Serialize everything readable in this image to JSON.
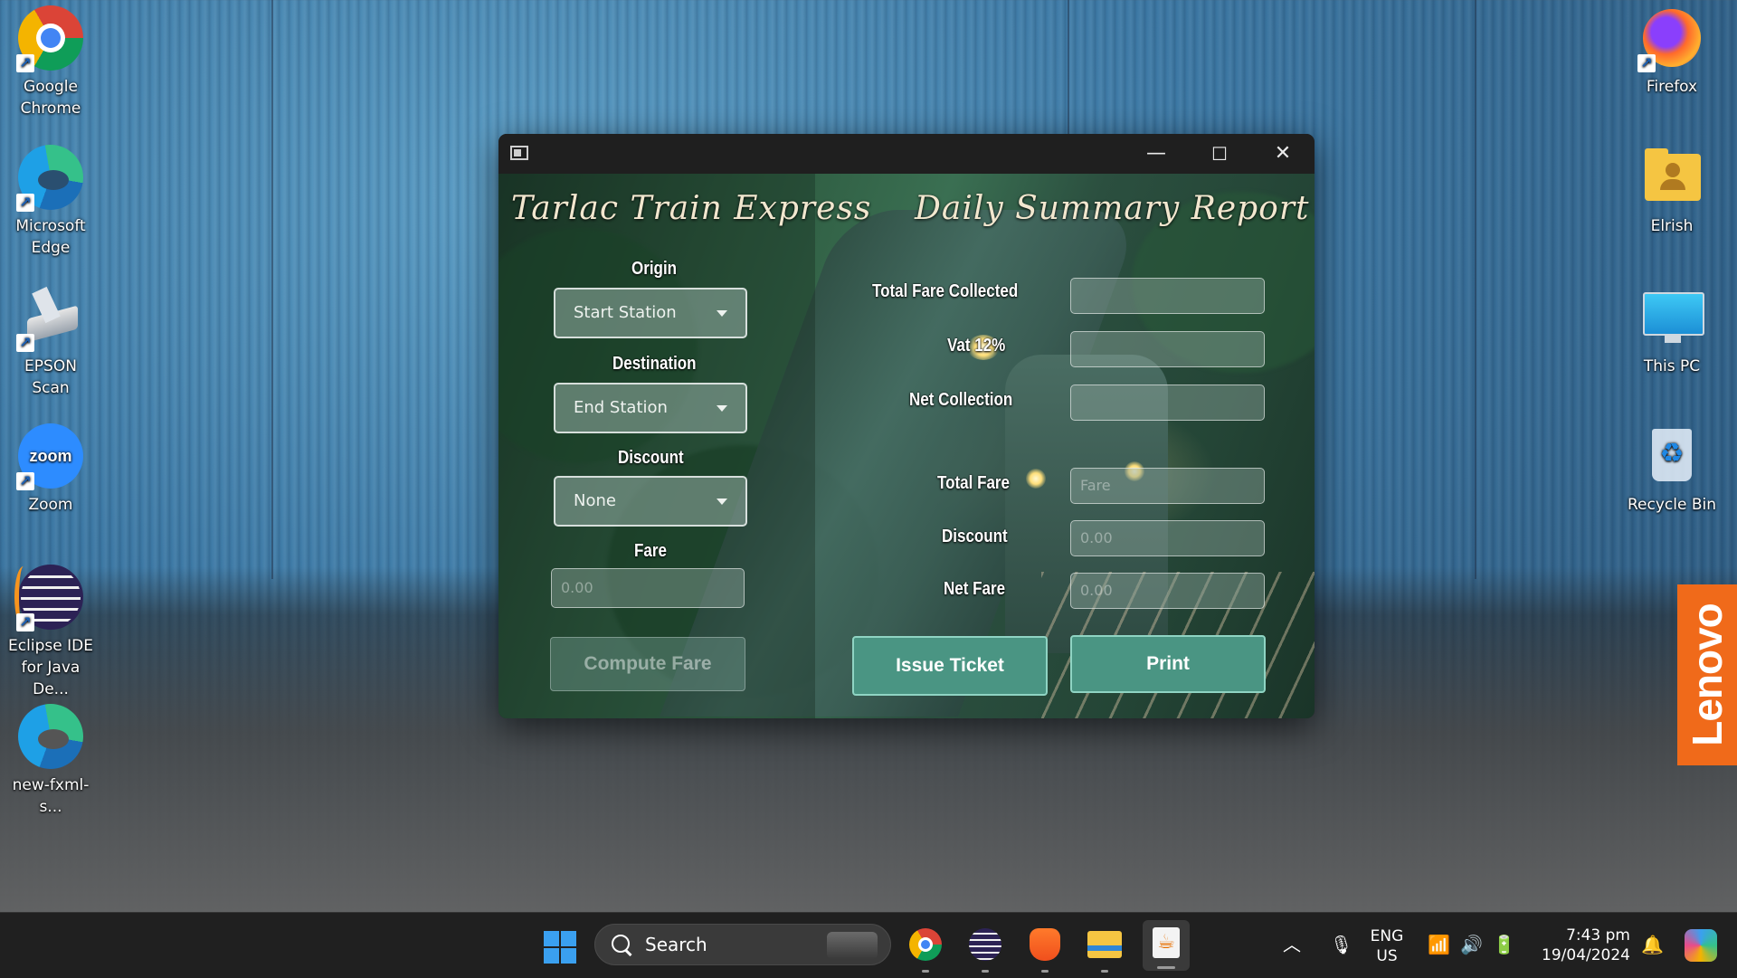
{
  "desktop": {
    "icons_left": [
      {
        "label": "Google Chrome",
        "icon": "chrome-icon"
      },
      {
        "label": "Microsoft Edge",
        "icon": "edge-icon"
      },
      {
        "label": "EPSON Scan",
        "icon": "scanner-icon"
      },
      {
        "label": "Zoom",
        "icon": "zoom-icon"
      },
      {
        "label": "Eclipse IDE for Java De...",
        "icon": "eclipse-icon"
      },
      {
        "label": "new-fxml-s...",
        "icon": "edge-icon"
      }
    ],
    "icons_right": [
      {
        "label": "Firefox",
        "icon": "firefox-icon"
      },
      {
        "label": "Elrish",
        "icon": "user-folder-icon"
      },
      {
        "label": "This PC",
        "icon": "monitor-icon"
      },
      {
        "label": "Recycle Bin",
        "icon": "recycle-bin-icon"
      }
    ],
    "zoom_logo_text": "zoom",
    "lenovo_text": "Lenovo"
  },
  "window": {
    "controls": {
      "minimize": "—",
      "maximize": "☐",
      "close": "✕"
    },
    "left_title": "Tarlac Train Express",
    "right_title": "Daily Summary Report",
    "form": {
      "origin_label": "Origin",
      "origin_value": "Start Station",
      "destination_label": "Destination",
      "destination_value": "End Station",
      "discount_label": "Discount",
      "discount_value": "None",
      "fare_label": "Fare",
      "fare_value": "0.00",
      "compute_button": "Compute Fare"
    },
    "summary": {
      "total_fare_collected_label": "Total Fare Collected",
      "total_fare_collected_value": "",
      "vat_label": "Vat 12%",
      "vat_value": "",
      "net_collection_label": "Net Collection",
      "net_collection_value": "",
      "total_fare_label": "Total Fare",
      "total_fare_value": "Fare",
      "discount_label": "Discount",
      "discount_value": "0.00",
      "net_fare_label": "Net Fare",
      "net_fare_value": "0.00"
    },
    "issue_button": "Issue Ticket",
    "print_button": "Print",
    "accent_color": "#4a9583"
  },
  "taskbar": {
    "search_placeholder": "Search",
    "apps": [
      "chrome-icon",
      "eclipse-icon",
      "brave-icon",
      "file-explorer-icon",
      "java-icon"
    ],
    "language_top": "ENG",
    "language_bottom": "US",
    "time": "7:43 pm",
    "date": "19/04/2024"
  }
}
